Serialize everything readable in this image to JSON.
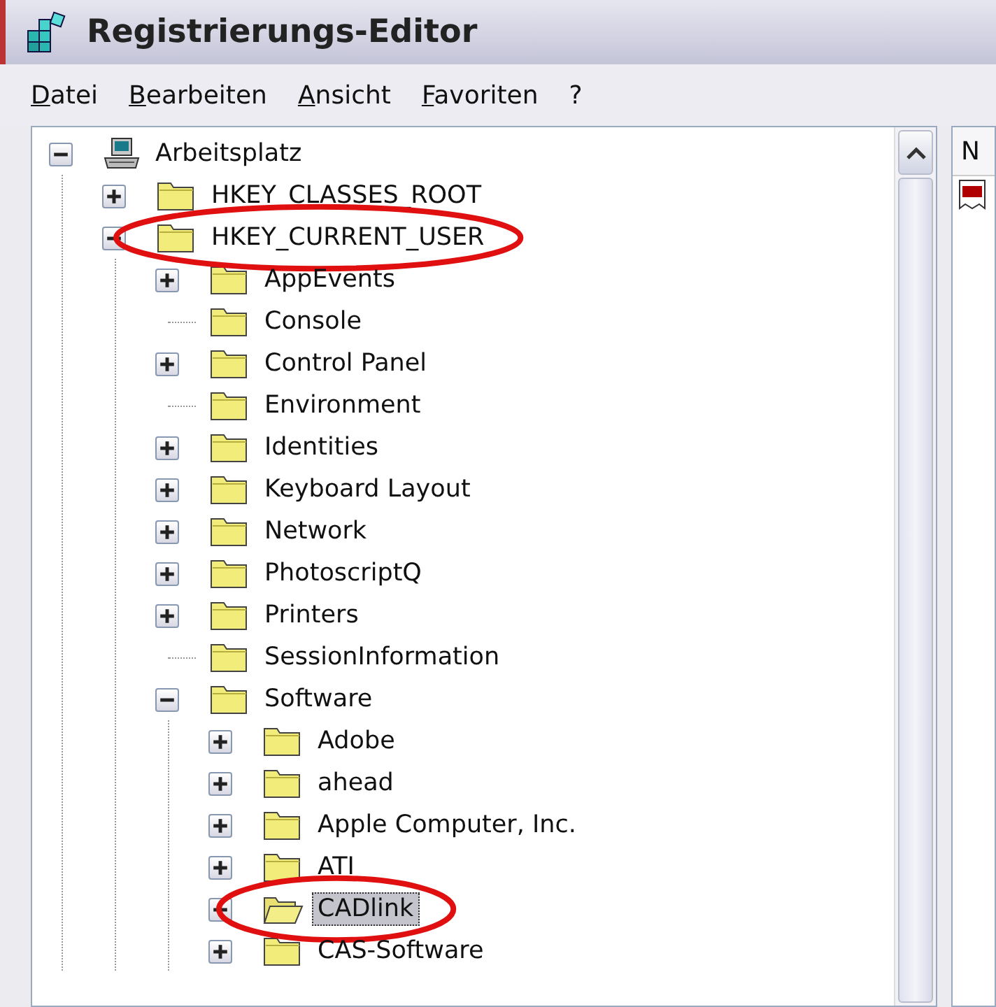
{
  "window": {
    "title": "Registrierungs-Editor"
  },
  "menu": [
    "Datei",
    "Bearbeiten",
    "Ansicht",
    "Favoriten",
    "?"
  ],
  "tree": [
    {
      "label": "Arbeitsplatz",
      "kind": "computer",
      "expandable": true,
      "expanded": true,
      "selected": false,
      "circled": false,
      "children": [
        {
          "label": "HKEY_CLASSES_ROOT",
          "kind": "folder",
          "expandable": true,
          "expanded": false,
          "selected": false,
          "circled": false
        },
        {
          "label": "HKEY_CURRENT_USER",
          "kind": "folder",
          "expandable": true,
          "expanded": true,
          "selected": false,
          "circled": true,
          "children": [
            {
              "label": "AppEvents",
              "kind": "folder",
              "expandable": true,
              "expanded": false,
              "selected": false,
              "circled": false
            },
            {
              "label": "Console",
              "kind": "folder",
              "expandable": false,
              "selected": false,
              "circled": false
            },
            {
              "label": "Control Panel",
              "kind": "folder",
              "expandable": true,
              "expanded": false,
              "selected": false,
              "circled": false
            },
            {
              "label": "Environment",
              "kind": "folder",
              "expandable": false,
              "selected": false,
              "circled": false
            },
            {
              "label": "Identities",
              "kind": "folder",
              "expandable": true,
              "expanded": false,
              "selected": false,
              "circled": false
            },
            {
              "label": "Keyboard Layout",
              "kind": "folder",
              "expandable": true,
              "expanded": false,
              "selected": false,
              "circled": false
            },
            {
              "label": "Network",
              "kind": "folder",
              "expandable": true,
              "expanded": false,
              "selected": false,
              "circled": false
            },
            {
              "label": "PhotoscriptQ",
              "kind": "folder",
              "expandable": true,
              "expanded": false,
              "selected": false,
              "circled": false
            },
            {
              "label": "Printers",
              "kind": "folder",
              "expandable": true,
              "expanded": false,
              "selected": false,
              "circled": false
            },
            {
              "label": "SessionInformation",
              "kind": "folder",
              "expandable": false,
              "selected": false,
              "circled": false
            },
            {
              "label": "Software",
              "kind": "folder",
              "expandable": true,
              "expanded": true,
              "selected": false,
              "circled": false,
              "children": [
                {
                  "label": "Adobe",
                  "kind": "folder",
                  "expandable": true,
                  "expanded": false,
                  "selected": false,
                  "circled": false
                },
                {
                  "label": "ahead",
                  "kind": "folder",
                  "expandable": true,
                  "expanded": false,
                  "selected": false,
                  "circled": false
                },
                {
                  "label": "Apple Computer, Inc.",
                  "kind": "folder",
                  "expandable": true,
                  "expanded": false,
                  "selected": false,
                  "circled": false
                },
                {
                  "label": "ATI",
                  "kind": "folder",
                  "expandable": true,
                  "expanded": false,
                  "selected": false,
                  "circled": false
                },
                {
                  "label": "CADlink",
                  "kind": "folder",
                  "expandable": true,
                  "expanded": true,
                  "selected": true,
                  "circled": true
                },
                {
                  "label": "CAS-Software",
                  "kind": "folder",
                  "expandable": true,
                  "expanded": false,
                  "selected": false,
                  "circled": false
                }
              ]
            }
          ]
        }
      ]
    }
  ],
  "list": {
    "columns": [
      "N"
    ]
  }
}
